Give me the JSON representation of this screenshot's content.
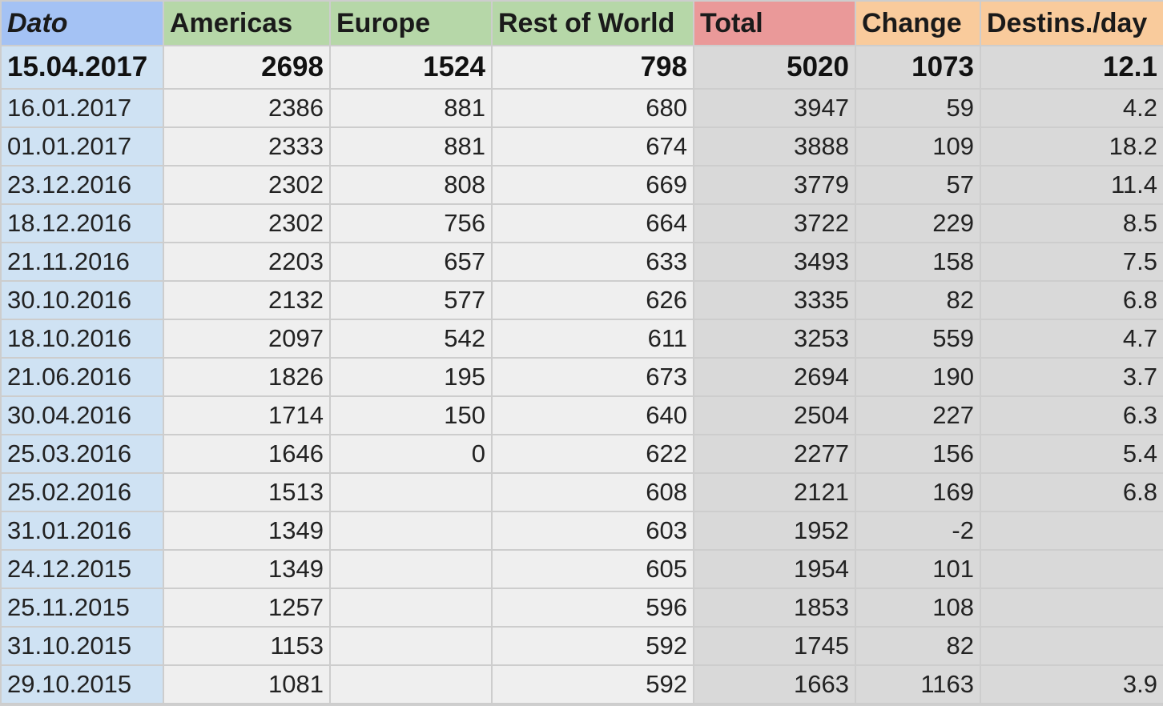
{
  "columns": [
    "Dato",
    "Americas",
    "Europe",
    "Rest of World",
    "Total",
    "Change",
    "Destins./day"
  ],
  "rows": [
    [
      "15.04.2017",
      "2698",
      "1524",
      "798",
      "5020",
      "1073",
      "12.1"
    ],
    [
      "16.01.2017",
      "2386",
      "881",
      "680",
      "3947",
      "59",
      "4.2"
    ],
    [
      "01.01.2017",
      "2333",
      "881",
      "674",
      "3888",
      "109",
      "18.2"
    ],
    [
      "23.12.2016",
      "2302",
      "808",
      "669",
      "3779",
      "57",
      "11.4"
    ],
    [
      "18.12.2016",
      "2302",
      "756",
      "664",
      "3722",
      "229",
      "8.5"
    ],
    [
      "21.11.2016",
      "2203",
      "657",
      "633",
      "3493",
      "158",
      "7.5"
    ],
    [
      "30.10.2016",
      "2132",
      "577",
      "626",
      "3335",
      "82",
      "6.8"
    ],
    [
      "18.10.2016",
      "2097",
      "542",
      "611",
      "3253",
      "559",
      "4.7"
    ],
    [
      "21.06.2016",
      "1826",
      "195",
      "673",
      "2694",
      "190",
      "3.7"
    ],
    [
      "30.04.2016",
      "1714",
      "150",
      "640",
      "2504",
      "227",
      "6.3"
    ],
    [
      "25.03.2016",
      "1646",
      "0",
      "622",
      "2277",
      "156",
      "5.4"
    ],
    [
      "25.02.2016",
      "1513",
      "",
      "608",
      "2121",
      "169",
      "6.8"
    ],
    [
      "31.01.2016",
      "1349",
      "",
      "603",
      "1952",
      "-2",
      ""
    ],
    [
      "24.12.2015",
      "1349",
      "",
      "605",
      "1954",
      "101",
      ""
    ],
    [
      "25.11.2015",
      "1257",
      "",
      "596",
      "1853",
      "108",
      ""
    ],
    [
      "31.10.2015",
      "1153",
      "",
      "592",
      "1745",
      "82",
      ""
    ],
    [
      "29.10.2015",
      "1081",
      "",
      "592",
      "1663",
      "1163",
      "3.9"
    ]
  ]
}
